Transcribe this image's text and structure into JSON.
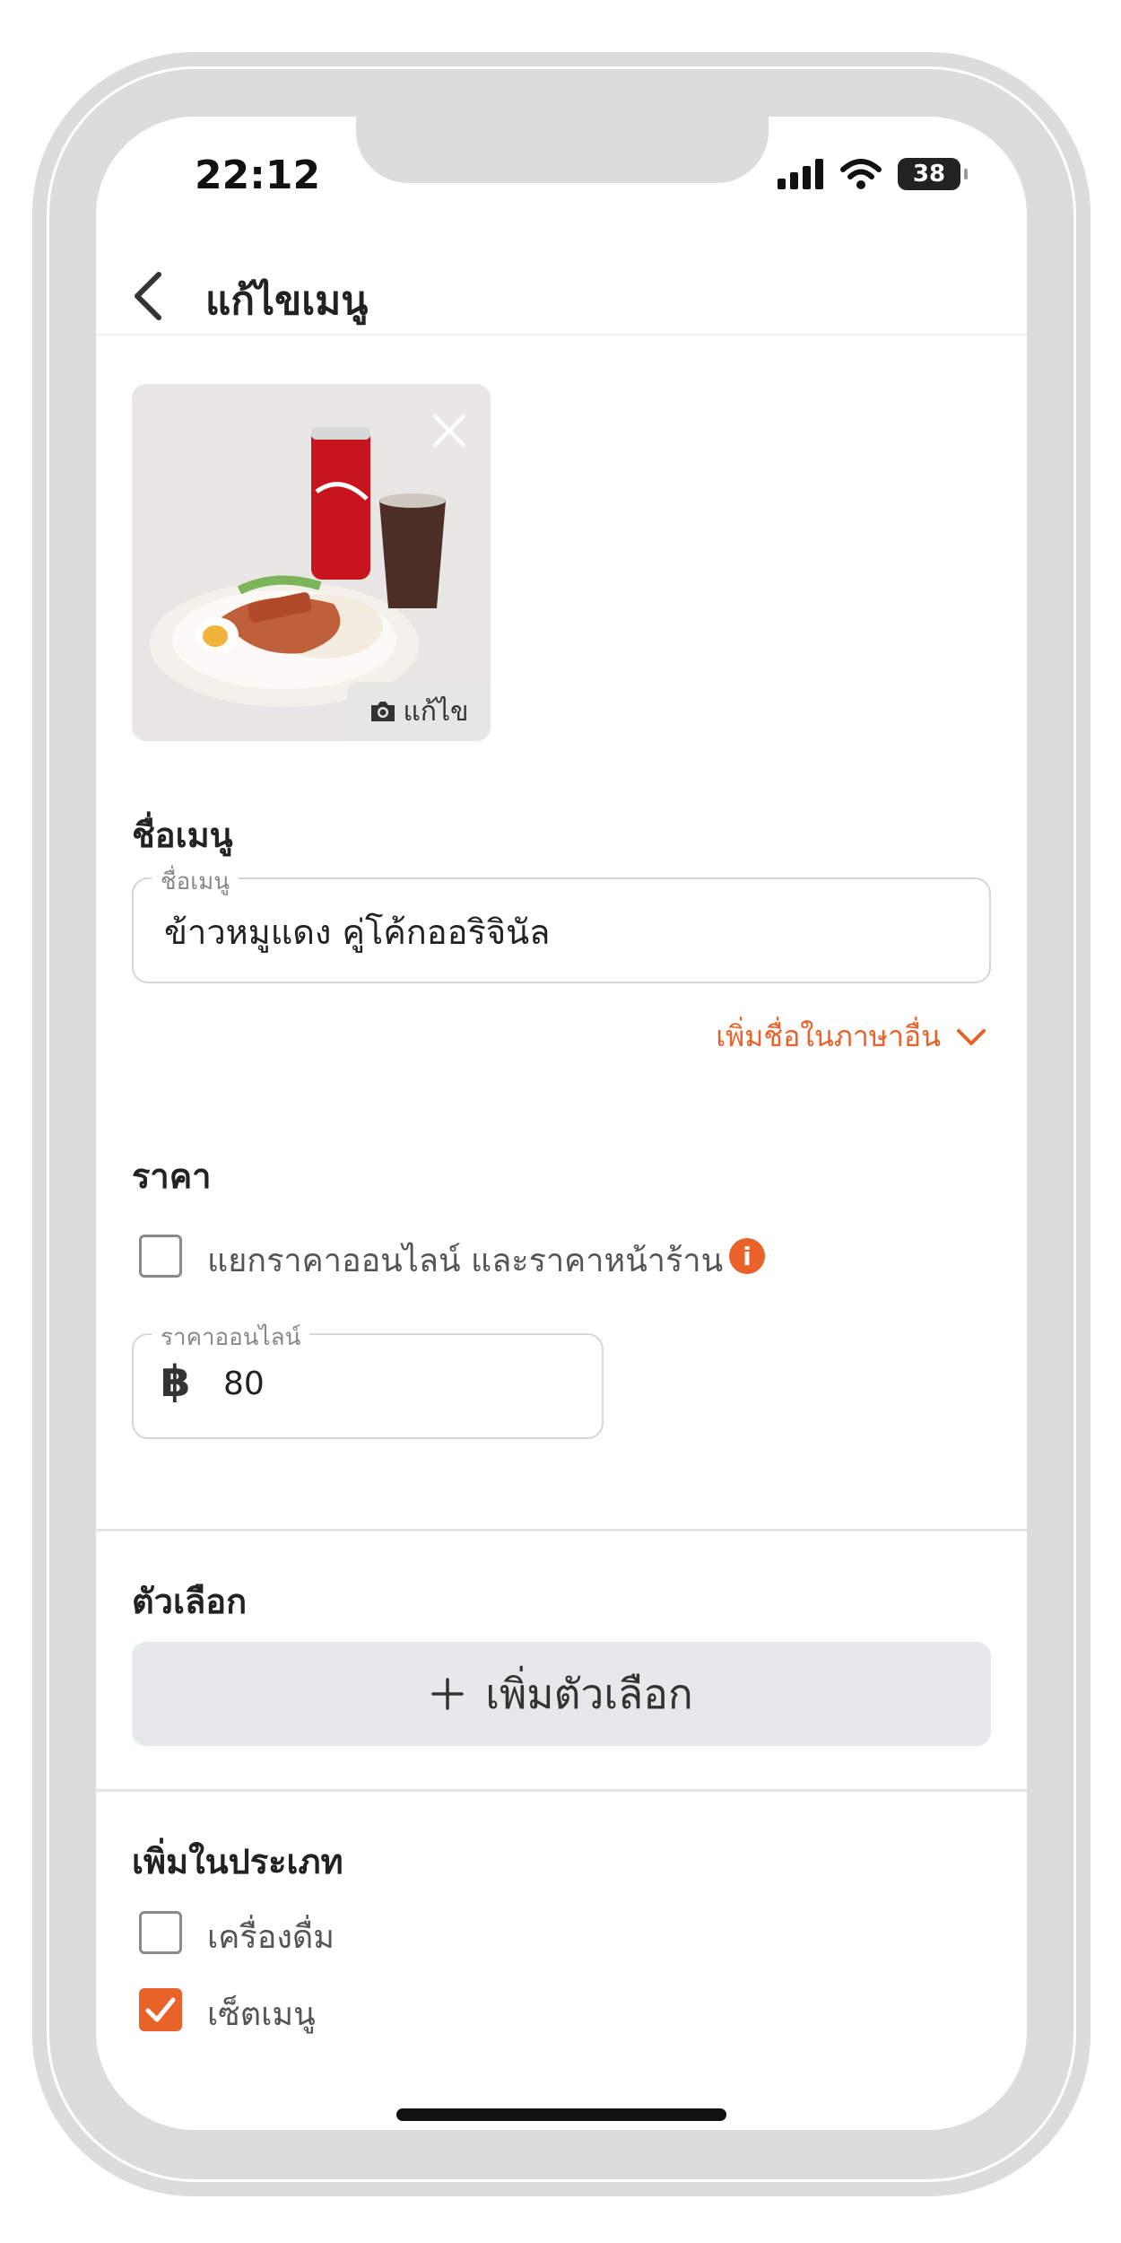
{
  "status_bar": {
    "time": "22:12",
    "battery": "38"
  },
  "header": {
    "title": "แก้ไขเมนู"
  },
  "photo": {
    "edit_label": "แก้ไข"
  },
  "menu_name": {
    "section_title": "ชื่อเมนู",
    "field_label": "ชื่อเมนู",
    "value": "ข้าวหมูแดง คู่โค้กออริจินัล",
    "add_language_link": "เพิ่มชื่อในภาษาอื่น"
  },
  "price": {
    "section_title": "ราคา",
    "split_price_label": "แยกราคาออนไลน์ และราคาหน้าร้าน",
    "split_price_checked": false,
    "online_price_label": "ราคาออนไลน์",
    "currency_symbol": "฿",
    "online_price_value": "80"
  },
  "options": {
    "section_title": "ตัวเลือก",
    "add_button_label": "เพิ่มตัวเลือก"
  },
  "categories": {
    "section_title": "เพิ่มในประเภท",
    "items": [
      {
        "label": "เครื่องดื่ม",
        "checked": false
      },
      {
        "label": "เซ็ตเมนู",
        "checked": true
      }
    ]
  },
  "colors": {
    "accent": "#e8622a",
    "frame": "#dcdcdc",
    "button_bg": "#e6e9ea"
  }
}
